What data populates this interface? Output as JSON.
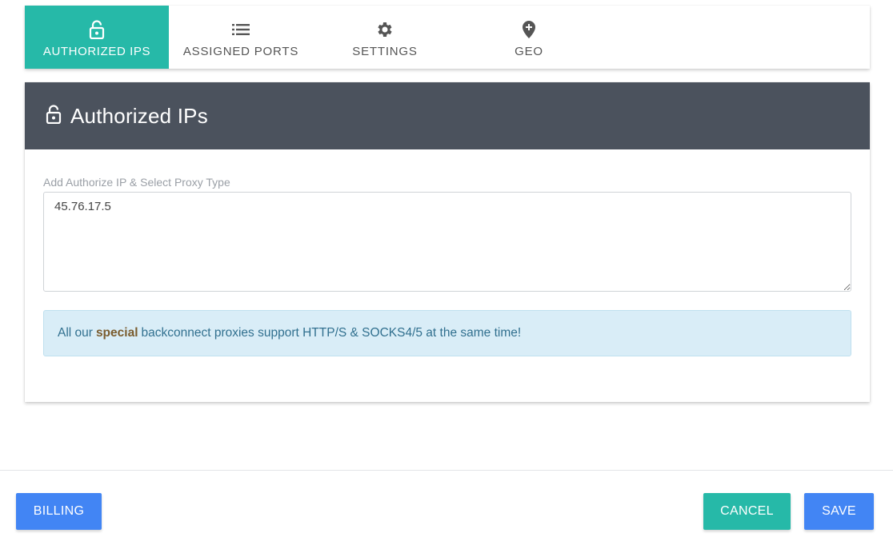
{
  "tabs": [
    {
      "label": "AUTHORIZED IPS",
      "icon": "lock-icon",
      "active": true
    },
    {
      "label": "ASSIGNED PORTS",
      "icon": "list-icon",
      "active": false
    },
    {
      "label": "SETTINGS",
      "icon": "gear-icon",
      "active": false
    },
    {
      "label": "GEO",
      "icon": "map-marker-plus-icon",
      "active": false
    }
  ],
  "panel": {
    "title": "Authorized IPs",
    "icon": "lock-icon",
    "field_label": "Add Authorize IP & Select Proxy Type",
    "textarea_value": "45.76.17.5",
    "info_before": "All our",
    "info_highlight": "special",
    "info_after": "backconnect proxies support HTTP/S & SOCKS4/5 at the same time!"
  },
  "footer": {
    "billing_label": "BILLING",
    "cancel_label": "CANCEL",
    "save_label": "SAVE"
  },
  "colors": {
    "accent_teal": "#26b9a8",
    "primary_blue": "#4285f4",
    "header_dark": "#4b525d",
    "info_bg": "#d9edf7",
    "info_text": "#31708f",
    "highlight_text": "#7a5c2e"
  }
}
